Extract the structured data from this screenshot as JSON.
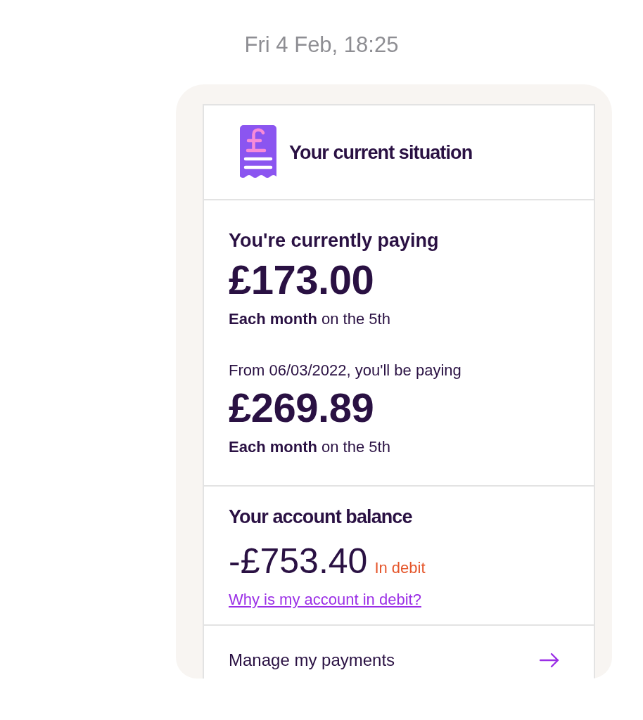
{
  "timestamp": "Fri 4 Feb, 18:25",
  "card": {
    "title": "Your current situation",
    "payments": [
      {
        "kind": "current",
        "label": "You're currently paying",
        "amount": "£173.00",
        "schedule": "**Each month** on the 5th"
      },
      {
        "kind": "upcoming",
        "label": "From 06/03/2022, you'll be paying",
        "amount": "£269.89",
        "schedule": "**Each month** on the 5th"
      }
    ],
    "balance": {
      "title": "Your account balance",
      "amount": "-£753.40",
      "status": "In debit",
      "link": "Why is my account in debit?"
    },
    "actions": [
      {
        "label": "Manage my payments"
      }
    ]
  }
}
